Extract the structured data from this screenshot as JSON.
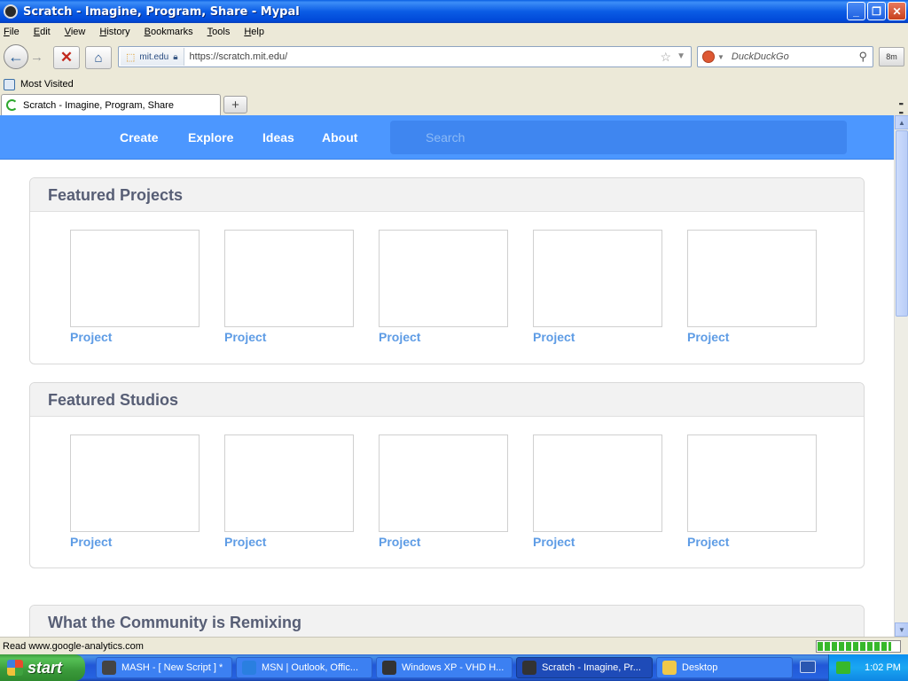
{
  "window": {
    "title": "Scratch - Imagine, Program, Share - Mypal",
    "controls": {
      "minimize": "_",
      "maximize": "❐",
      "close": "✕"
    }
  },
  "menu": [
    "File",
    "Edit",
    "View",
    "History",
    "Bookmarks",
    "Tools",
    "Help"
  ],
  "toolbar": {
    "back": "←",
    "forward": "→",
    "stop": "✕",
    "home": "⌂",
    "identity_domain": "mit.edu",
    "url": "https://scratch.mit.edu/",
    "search_placeholder": "DuckDuckGo",
    "ext_badge": "8m"
  },
  "bookmarks": {
    "most_visited": "Most Visited"
  },
  "tabs": [
    {
      "label": "Scratch - Imagine, Program, Share"
    }
  ],
  "site": {
    "nav": [
      "Create",
      "Explore",
      "Ideas",
      "About"
    ],
    "search_placeholder": "Search",
    "sections": [
      {
        "title": "Featured Projects",
        "items": [
          "Project",
          "Project",
          "Project",
          "Project",
          "Project"
        ]
      },
      {
        "title": "Featured Studios",
        "items": [
          "Project",
          "Project",
          "Project",
          "Project",
          "Project"
        ]
      },
      {
        "title": "What the Community is Remixing"
      }
    ]
  },
  "status": {
    "text": "Read www.google-analytics.com",
    "progress_fraction": 0.9
  },
  "taskbar": {
    "start": "start",
    "tasks": [
      {
        "label": "MASH - [ New Script ] *"
      },
      {
        "label": "MSN | Outlook, Offic..."
      },
      {
        "label": "Windows XP - VHD H..."
      },
      {
        "label": "Scratch - Imagine, Pr..."
      },
      {
        "label": "Desktop"
      }
    ],
    "clock": "1:02 PM"
  },
  "colors": {
    "scratch_blue": "#4C97FF",
    "link_blue": "#5e9ce5",
    "header_text": "#575e75"
  }
}
